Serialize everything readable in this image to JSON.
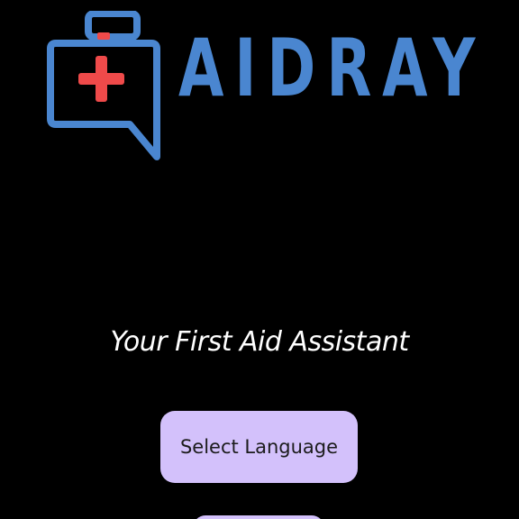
{
  "app": {
    "brand_name": "AIDRAY",
    "brand_color": "#4a86d0",
    "cross_color": "#ef4a4a"
  },
  "logo": {
    "icon": "first-aid-kit-speech-bubble-icon"
  },
  "main": {
    "tagline": "Your First Aid Assistant",
    "select_language_label": "Select Language",
    "button_color": "#d3c1fb"
  }
}
